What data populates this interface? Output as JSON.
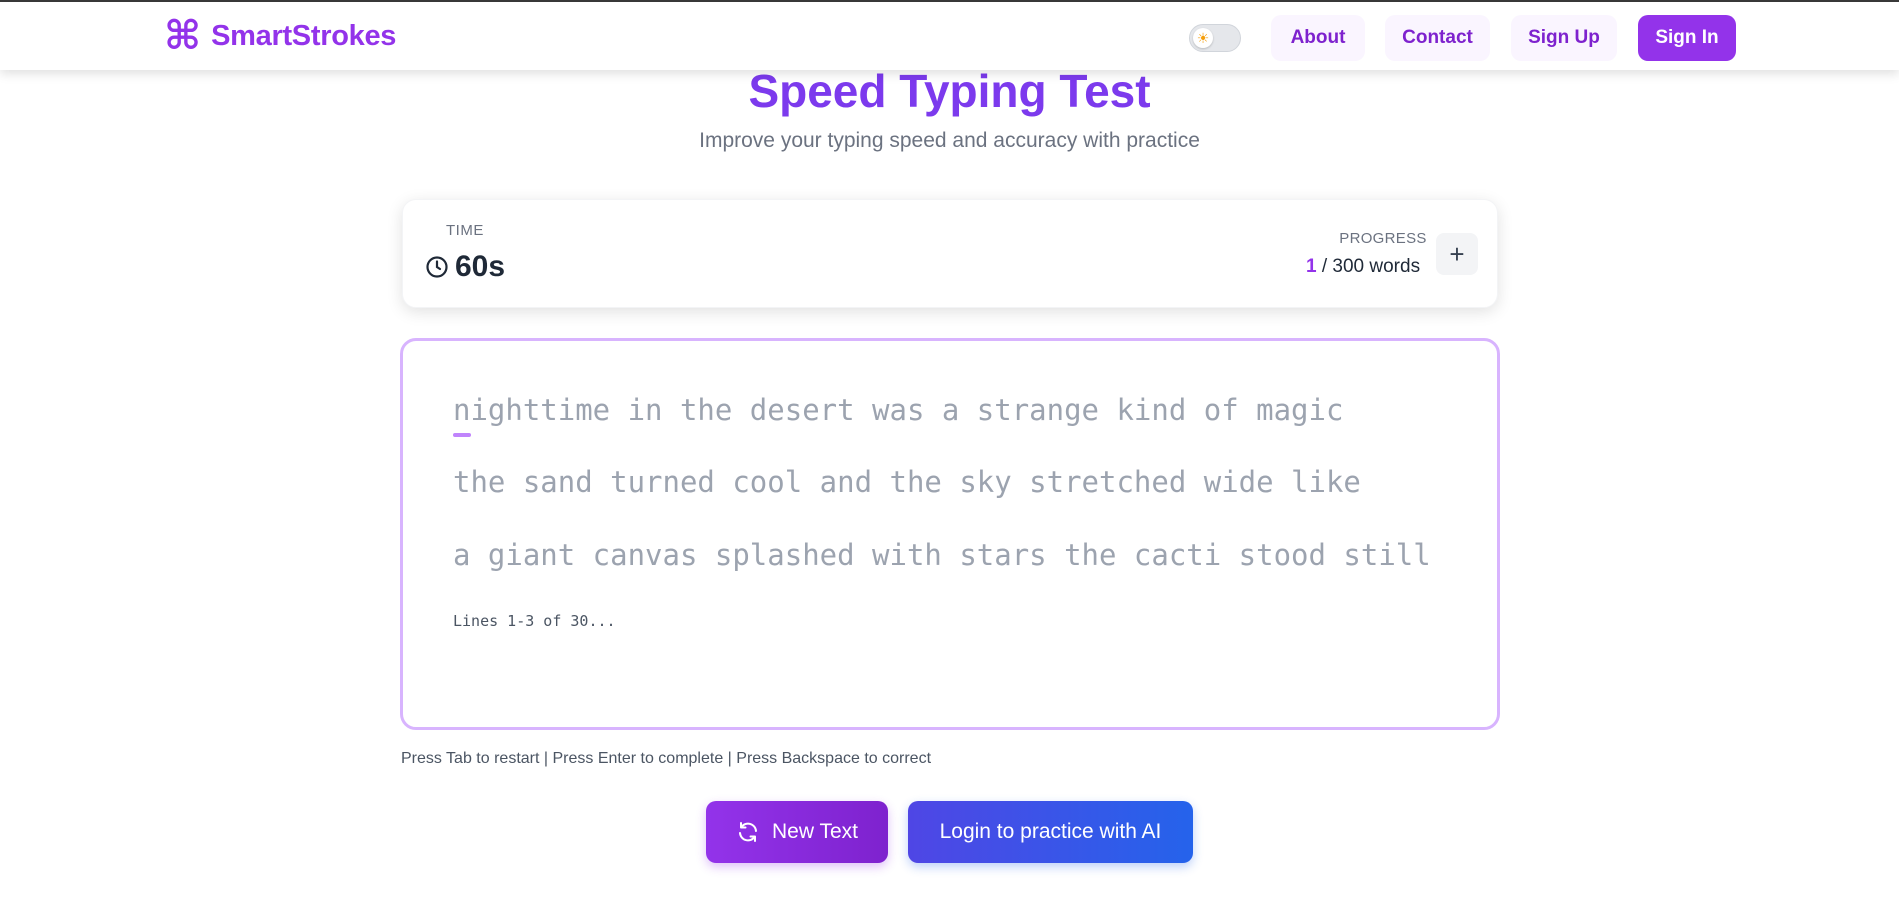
{
  "header": {
    "brand": "SmartStrokes",
    "logo_icon": "command-icon",
    "theme_toggle_icon": "sun-icon",
    "nav": {
      "about": "About",
      "contact": "Contact",
      "sign_up": "Sign Up",
      "sign_in": "Sign In"
    }
  },
  "main": {
    "title": "Speed Typing Test",
    "subtitle": "Improve your typing speed and accuracy with practice"
  },
  "stats": {
    "time_label": "TIME",
    "time_value": "60s",
    "progress_label": "PROGRESS",
    "progress_current": "1",
    "progress_total": " / 300 words"
  },
  "typing": {
    "lines": [
      "nighttime in the desert was a strange kind of magic",
      "the sand turned cool and the sky stretched wide like",
      "a giant canvas splashed with stars the cacti stood still"
    ],
    "lines_info": "Lines 1-3 of 30..."
  },
  "hint": "Press Tab to restart | Press Enter to complete | Press Backspace to correct",
  "actions": {
    "new_text": "New Text",
    "login_ai": "Login to practice with AI"
  },
  "colors": {
    "brand": "#9333ea",
    "title": "#7c3aed",
    "ai_button_start": "#4f46e5",
    "ai_button_end": "#2563eb"
  }
}
